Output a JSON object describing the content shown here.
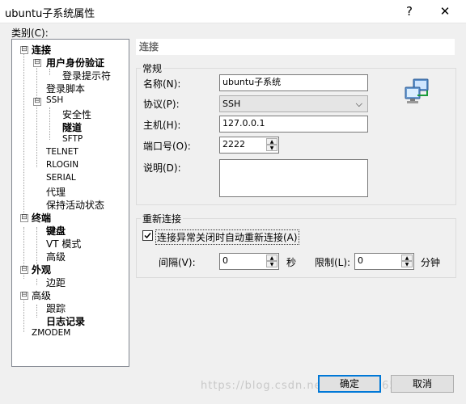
{
  "window": {
    "title": "ubuntu子系统属性",
    "help_label": "?",
    "close_label": "✕"
  },
  "category_label": "类别(C):",
  "tree": [
    {
      "label": "连接",
      "expander": "⊟"
    },
    {
      "label": "用户身份验证",
      "expander": "⊟"
    },
    {
      "label": "登录提示符"
    },
    {
      "label": "登录脚本"
    },
    {
      "label": "SSH",
      "expander": "⊟"
    },
    {
      "label": "安全性"
    },
    {
      "label": "隧道"
    },
    {
      "label": "SFTP"
    },
    {
      "label": "TELNET"
    },
    {
      "label": "RLOGIN"
    },
    {
      "label": "SERIAL"
    },
    {
      "label": "代理"
    },
    {
      "label": "保持活动状态"
    },
    {
      "label": "终端",
      "expander": "⊟"
    },
    {
      "label": "键盘"
    },
    {
      "label": "VT 模式"
    },
    {
      "label": "高级"
    },
    {
      "label": "外观",
      "expander": "⊟"
    },
    {
      "label": "边距"
    },
    {
      "label": "高级",
      "expander": "⊟"
    },
    {
      "label": "跟踪"
    },
    {
      "label": "日志记录"
    },
    {
      "label": "ZMODEM"
    }
  ],
  "pane": {
    "title": "连接"
  },
  "general": {
    "group_label": "常规",
    "name_label": "名称(N):",
    "name_value": "ubuntu子系统",
    "protocol_label": "协议(P):",
    "protocol_value": "SSH",
    "protocol_arrow": "⌵",
    "host_label": "主机(H):",
    "host_value": "127.0.0.1",
    "port_label": "端口号(O):",
    "port_value": "2222",
    "desc_label": "说明(D):",
    "desc_value": ""
  },
  "reconnect": {
    "group_label": "重新连接",
    "checkbox_label": "连接异常关闭时自动重新连接(A)",
    "checked": true,
    "interval_label": "间隔(V):",
    "interval_value": "0",
    "interval_unit": "秒",
    "limit_label": "限制(L):",
    "limit_value": "0",
    "limit_unit": "分钟"
  },
  "buttons": {
    "ok": "确定",
    "cancel": "取消"
  },
  "spinner": {
    "up": "▲",
    "down": "▼"
  },
  "watermark": "https://blog.csdn.net/qq_33316586",
  "colors": {
    "accent": "#0078d7"
  }
}
